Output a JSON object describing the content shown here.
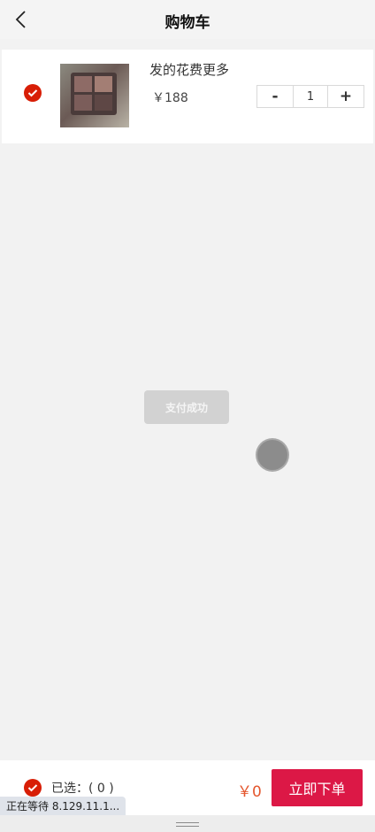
{
  "header": {
    "title": "购物车",
    "back_icon": "chevron-left-icon"
  },
  "cart": {
    "items": [
      {
        "checked": true,
        "name": "发的花费更多",
        "price": "￥188",
        "quantity": "1",
        "minus_label": "-",
        "plus_label": "+"
      }
    ]
  },
  "toast": {
    "text": "支付成功"
  },
  "footer": {
    "select_all_checked": true,
    "selected_label": "已选：( 0 )",
    "total": "￥0",
    "order_button": "立即下单"
  },
  "browser": {
    "status_text": "正在等待 8.129.11.1..."
  },
  "colors": {
    "accent_red": "#d81e06",
    "order_button": "#dc1846",
    "total_price": "#e4572e",
    "page_background": "#f2f2f2"
  }
}
